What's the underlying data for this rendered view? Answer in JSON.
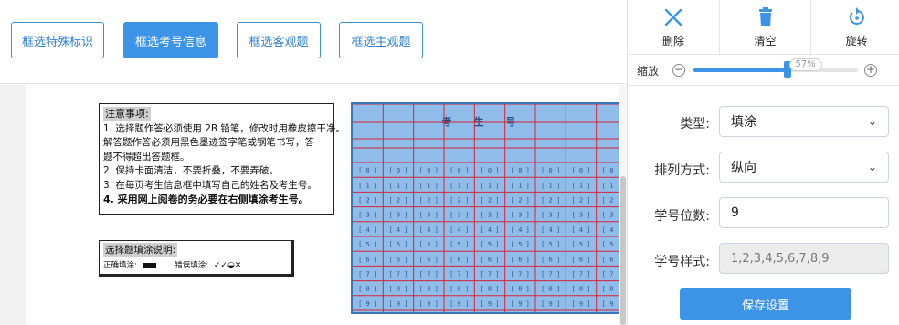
{
  "toolbar": {
    "buttons": [
      {
        "label": "框选特殊标识",
        "active": false
      },
      {
        "label": "框选考号信息",
        "active": true
      },
      {
        "label": "框选客观题",
        "active": false
      },
      {
        "label": "框选主观题",
        "active": false
      }
    ]
  },
  "sheet": {
    "notes": {
      "title": "注意事项:",
      "lines": [
        "1. 选择题作答必须使用 2B 铅笔，修改时用橡皮擦干净。",
        "   解答题作答必须用黑色墨迹签字笔或钢笔书写，答",
        "   题不得超出答题框。",
        "2. 保持卡面清洁，不要折叠，不要弄破。",
        "3. 在每页考生信息框中填写自己的姓名及考生号。"
      ],
      "bold_line": "4. 采用网上阅卷的务必要在右侧填涂考生号。"
    },
    "choice_box": {
      "title": "选择题填涂说明:",
      "correct_label": "正确填涂:",
      "wrong_label": "错误填涂:"
    },
    "grid": {
      "title": "考生号",
      "columns": 9,
      "digits": [
        "0",
        "1",
        "2",
        "3",
        "4",
        "5",
        "6",
        "7",
        "8",
        "9"
      ]
    }
  },
  "panel": {
    "actions": [
      {
        "label": "删除",
        "icon": "close-icon"
      },
      {
        "label": "清空",
        "icon": "trash-icon"
      },
      {
        "label": "旋转",
        "icon": "rotate-icon"
      }
    ],
    "zoom": {
      "label": "缩放",
      "value": 57,
      "value_text": "57%"
    },
    "fields": {
      "type_label": "类型:",
      "type_value": "填涂",
      "arrange_label": "排列方式:",
      "arrange_value": "纵向",
      "digits_label": "学号位数:",
      "digits_value": "9",
      "style_label": "学号样式:",
      "style_value": "1,2,3,4,5,6,7,8,9"
    },
    "save_label": "保存设置"
  },
  "colors": {
    "accent": "#3d94e6",
    "grid_fill": "#8fbce8",
    "grid_line": "#d3263a"
  }
}
